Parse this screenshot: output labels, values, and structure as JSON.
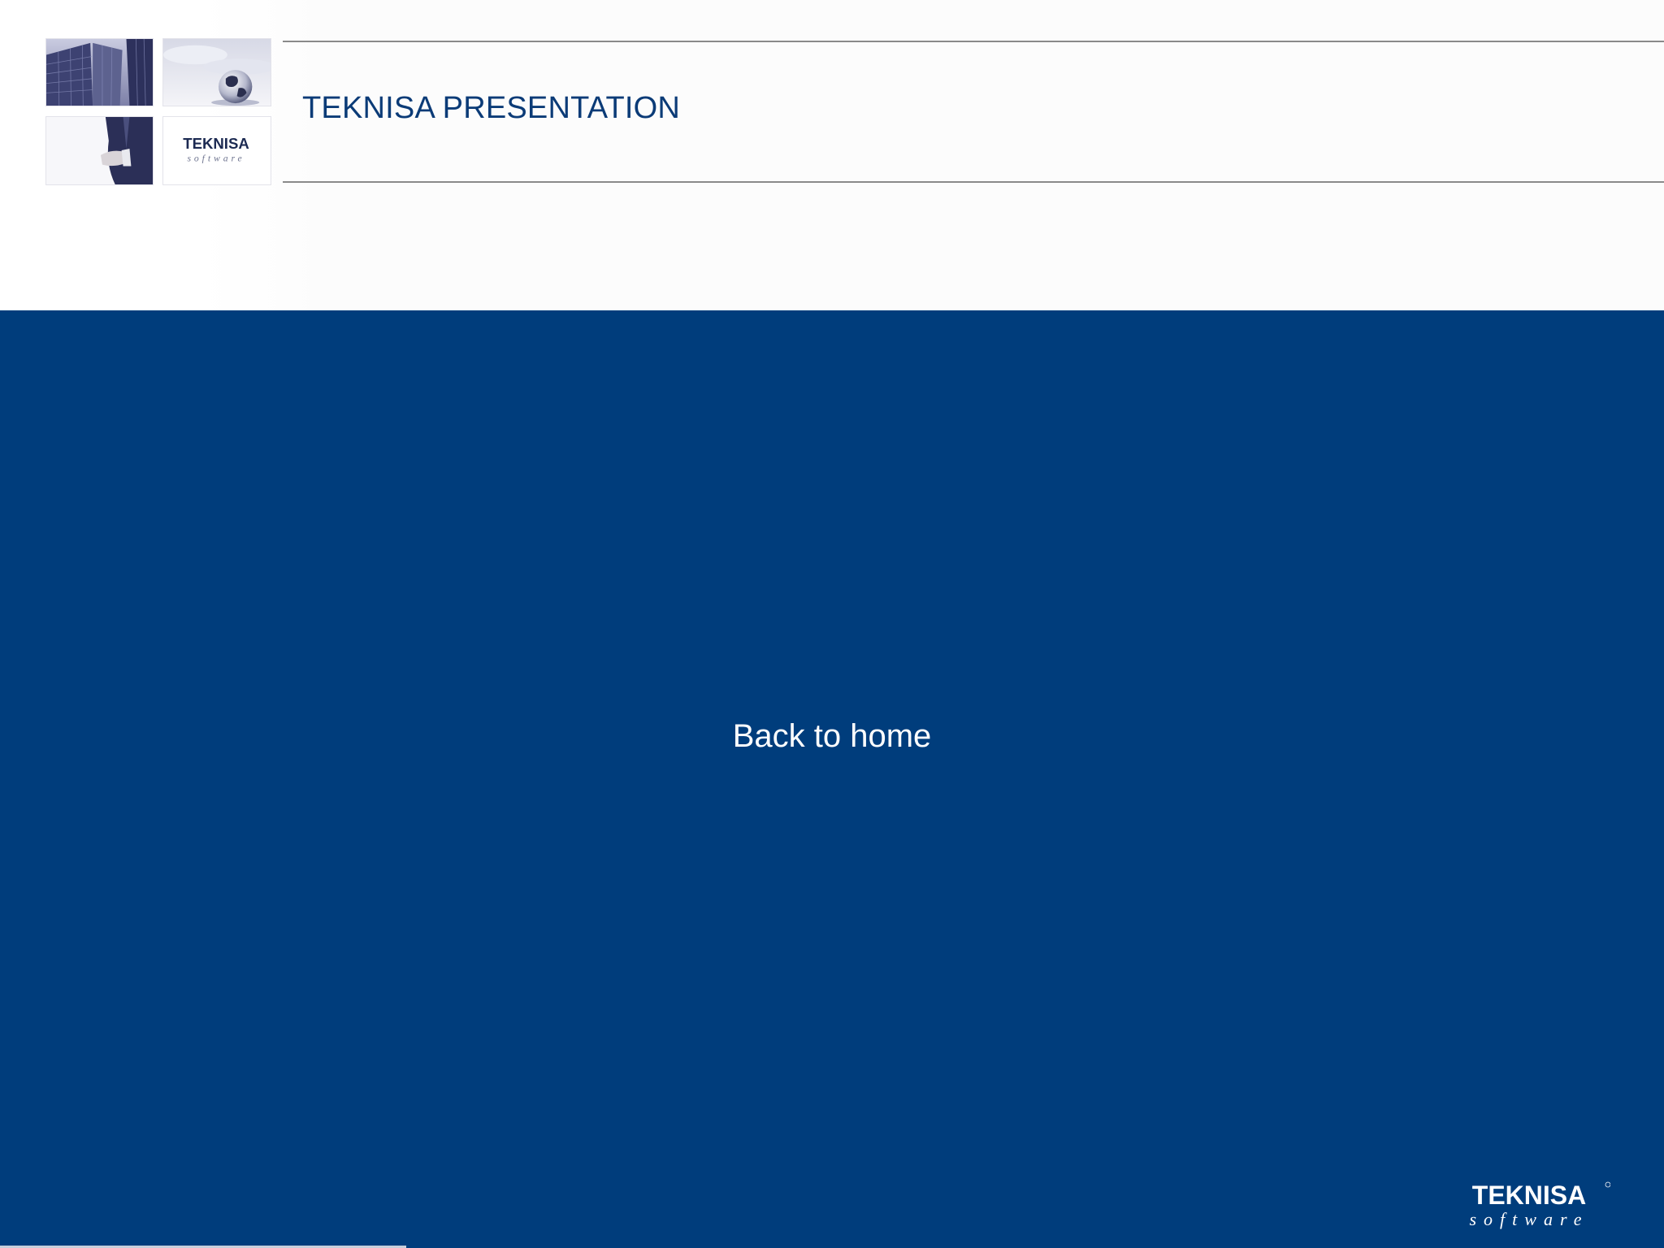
{
  "header": {
    "title": "TEKNISA PRESENTATION",
    "collage_logo": {
      "wordmark": "TEKNISA",
      "tagline": "software"
    }
  },
  "main": {
    "link_label": "Back to home"
  },
  "footer": {
    "logo": {
      "wordmark": "TEKNISA",
      "tagline": "software"
    }
  },
  "colors": {
    "brand_blue": "#003d7c",
    "title_blue": "#0b3b77",
    "rule_gray": "#8a8a8a",
    "text_white": "#ffffff"
  }
}
